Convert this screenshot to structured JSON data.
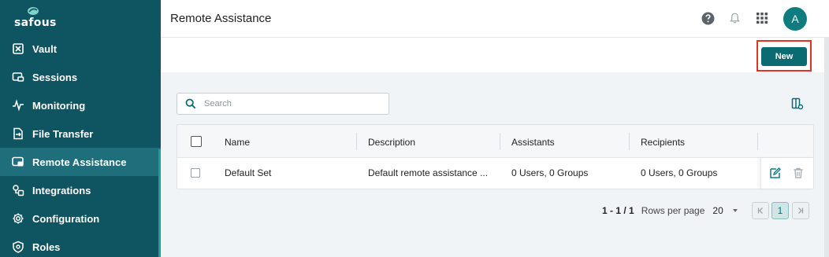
{
  "sidebar": {
    "logo_text": "safous",
    "items": [
      {
        "label": "Vault",
        "icon": "vault-icon"
      },
      {
        "label": "Sessions",
        "icon": "sessions-icon"
      },
      {
        "label": "Monitoring",
        "icon": "monitoring-icon"
      },
      {
        "label": "File Transfer",
        "icon": "file-transfer-icon"
      },
      {
        "label": "Remote Assistance",
        "icon": "remote-assistance-icon",
        "active": true
      },
      {
        "label": "Integrations",
        "icon": "integrations-icon"
      },
      {
        "label": "Configuration",
        "icon": "gear-icon"
      },
      {
        "label": "Roles",
        "icon": "shield-icon"
      }
    ]
  },
  "header": {
    "title": "Remote Assistance",
    "avatar_initial": "A",
    "icons": [
      "help-icon",
      "bell-icon",
      "apps-grid-icon"
    ]
  },
  "actions": {
    "new_label": "New"
  },
  "search": {
    "placeholder": "Search",
    "value": ""
  },
  "table": {
    "columns": [
      "Name",
      "Description",
      "Assistants",
      "Recipients"
    ],
    "rows": [
      {
        "name": "Default Set",
        "description": "Default remote assistance ...",
        "assistants": "0 Users, 0 Groups",
        "recipients": "0 Users, 0 Groups"
      }
    ]
  },
  "pagination": {
    "range": "1 - 1 / 1",
    "rows_per_page_label": "Rows per page",
    "rows_per_page": "20",
    "current_page": "1"
  },
  "colors": {
    "sidebar": "#0e5461",
    "accent": "#0b6b73",
    "highlight_border": "#e0351f"
  }
}
